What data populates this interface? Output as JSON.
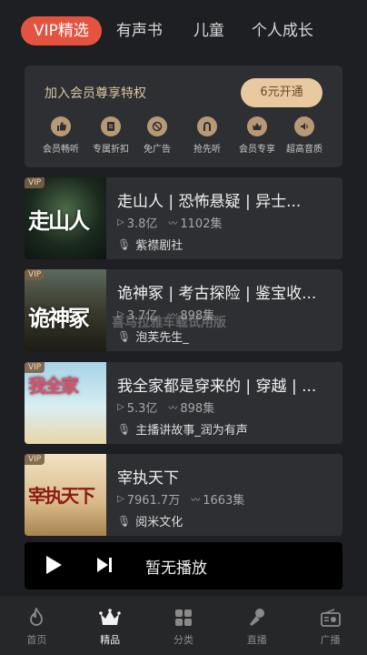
{
  "tabs": [
    "VIP精选",
    "有声书",
    "儿童",
    "个人成长"
  ],
  "vip": {
    "title": "加入会员尊享特权",
    "button": "6元开通",
    "perks": [
      {
        "label": "会员畅听",
        "icon": "thumb-icon"
      },
      {
        "label": "专属折扣",
        "icon": "discount-icon"
      },
      {
        "label": "免广告",
        "icon": "no-ads-icon"
      },
      {
        "label": "抢先听",
        "icon": "early-listen-icon"
      },
      {
        "label": "会员专享",
        "icon": "exclusive-icon"
      },
      {
        "label": "超高音质",
        "icon": "hq-audio-icon"
      }
    ]
  },
  "books": [
    {
      "title": "走山人 | 恐怖悬疑 | 异士...",
      "plays": "3.8亿",
      "episodes": "1102集",
      "author": "紫襟剧社",
      "cover_text": "走山人",
      "tag": "VIP",
      "cover_color": "#1f3a2a"
    },
    {
      "title": "诡神冢 | 考古探险 | 鉴宝收...",
      "plays": "3.7亿",
      "episodes": "898集",
      "author": "泡芙先生_",
      "cover_text": "诡神冢",
      "tag": "VIP",
      "cover_color": "#3d3a2c"
    },
    {
      "title": "我全家都是穿来的 | 穿越 | ...",
      "plays": "5.3亿",
      "episodes": "898集",
      "author": "主播讲故事_润为有声",
      "cover_text": "我全家",
      "tag": "VIP",
      "cover_color": "#8fc4d8"
    },
    {
      "title": "宰执天下",
      "plays": "7961.7万",
      "episodes": "1663集",
      "author": "阅米文化",
      "cover_text": "宰执天下",
      "tag": "VIP",
      "cover_color": "#d9b98a"
    }
  ],
  "watermark": "喜马拉雅车载试用版",
  "player": {
    "status": "暂无播放"
  },
  "nav": [
    {
      "label": "首页",
      "icon": "fire-icon"
    },
    {
      "label": "精品",
      "icon": "crown-icon"
    },
    {
      "label": "分类",
      "icon": "grid-icon"
    },
    {
      "label": "直播",
      "icon": "microphone-icon"
    },
    {
      "label": "广播",
      "icon": "radio-icon"
    }
  ]
}
